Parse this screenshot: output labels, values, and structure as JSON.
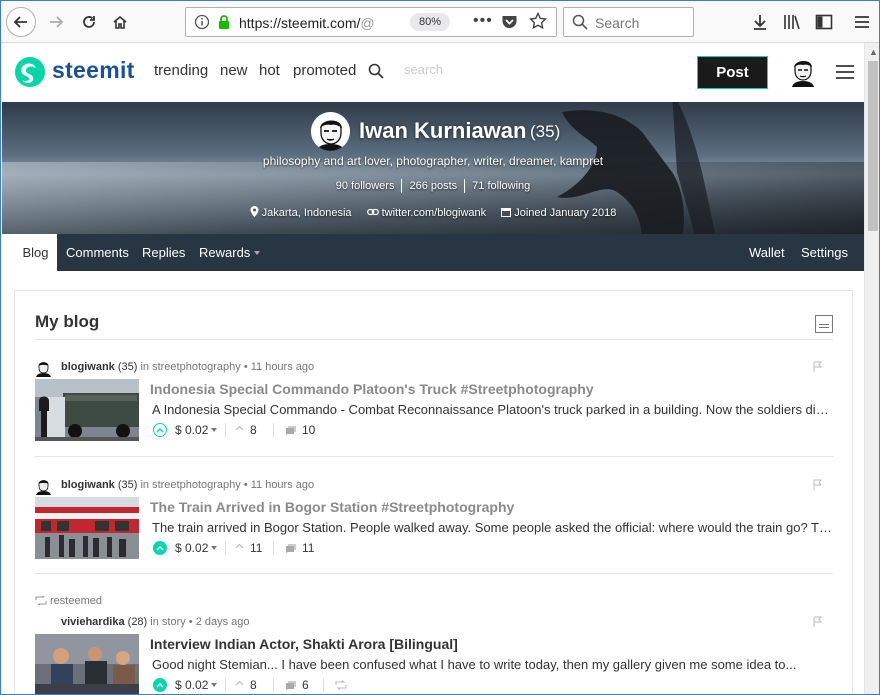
{
  "browser": {
    "url_main": "https://steemit.com/",
    "url_rest": "@",
    "zoom": "80%",
    "search_placeholder": "Search"
  },
  "header": {
    "brand": "steemit",
    "nav": [
      "trending",
      "new",
      "hot",
      "promoted"
    ],
    "search_placeholder": "search",
    "post_label": "Post"
  },
  "profile": {
    "name": "Iwan Kurniawan",
    "reputation": "(35)",
    "bio": "philosophy and art lover, photographer, writer, dreamer, kampret",
    "followers": "90 followers",
    "posts": "266 posts",
    "following": "71 following",
    "location": "Jakarta, Indonesia",
    "website": "twitter.com/blogiwank",
    "joined": "Joined January 2018"
  },
  "tabs": {
    "left": [
      "Blog",
      "Comments",
      "Replies",
      "Rewards"
    ],
    "right": [
      "Wallet",
      "Settings"
    ]
  },
  "blog": {
    "title": "My blog",
    "posts": [
      {
        "author": "blogiwank",
        "rep": "(35)",
        "meta": "in streetphotography • 11 hours ago",
        "title": "Indonesia Special Commando Platoon's Truck #Streetphotography",
        "body": "A Indonesia Special Commando - Combat Reconnaissance Platoon's truck parked in a building. Now the soldiers did not stay in the building.",
        "payout": "$ 0.02",
        "votes": "8",
        "comments": "10",
        "voted": false,
        "resteemed": ""
      },
      {
        "author": "blogiwank",
        "rep": "(35)",
        "meta": "in streetphotography • 11 hours ago",
        "title": "The Train Arrived in Bogor Station #Streetphotography",
        "body": "The train arrived in Bogor Station. People walked away. Some people asked the official: where would the train go? The official answered.",
        "payout": "$ 0.02",
        "votes": "11",
        "comments": "11",
        "voted": true,
        "resteemed": ""
      },
      {
        "author": "viviehardika",
        "rep": "(28)",
        "meta": "in story • 2 days ago",
        "title": "Interview Indian Actor, Shakti Arora [Bilingual]",
        "body": "Good night Stemian... I have been confused what I have to write today, then my gallery given me some idea to...",
        "payout": "$ 0.02",
        "votes": "8",
        "comments": "6",
        "voted": true,
        "resteemed": "resteemed"
      }
    ]
  },
  "colors": {
    "accent": "#06d6a9",
    "brand": "#1a5099",
    "tabbar": "#283542"
  }
}
